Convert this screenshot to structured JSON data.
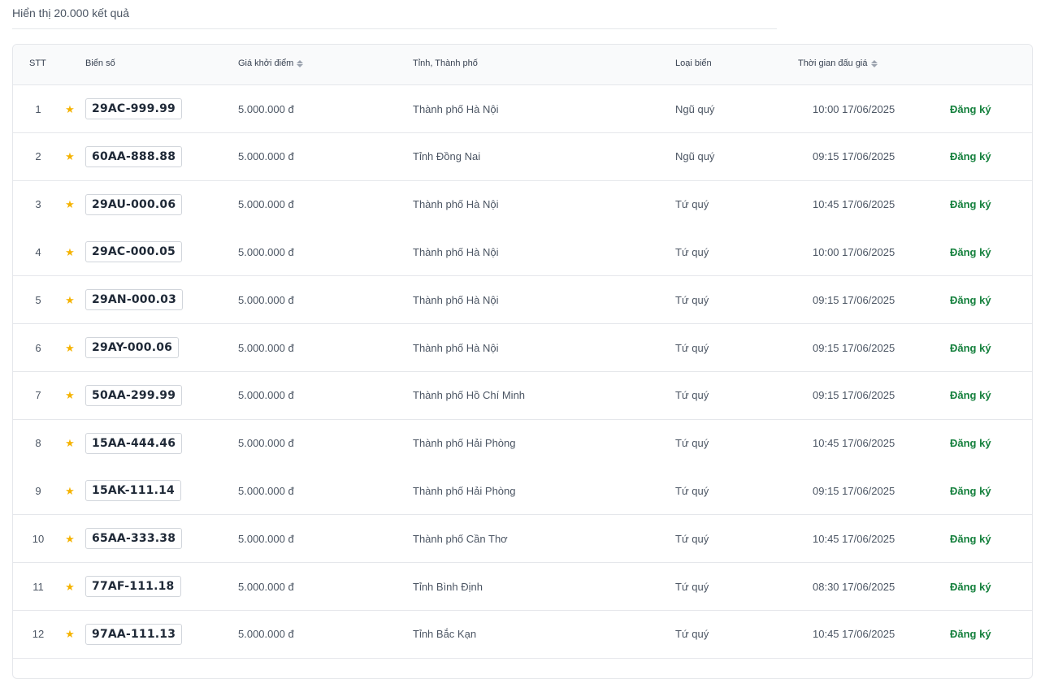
{
  "results": {
    "summary": "Hiển thị 20.000 kết quả"
  },
  "table": {
    "headers": {
      "stt": "STT",
      "plate": "Biển số",
      "price": "Giá khởi điểm",
      "province": "Tỉnh, Thành phố",
      "type": "Loại biển",
      "time": "Thời gian đấu giá"
    },
    "star_icon": "star-icon",
    "star_color": "#f5b301",
    "action_color": "#15803d",
    "rows": [
      {
        "stt": "1",
        "plate": "29AC-999.99",
        "price": "5.000.000 đ",
        "province": "Thành phố Hà Nội",
        "type": "Ngũ quý",
        "time": "10:00 17/06/2025",
        "action": "Đăng ký"
      },
      {
        "stt": "2",
        "plate": "60AA-888.88",
        "price": "5.000.000 đ",
        "province": "Tỉnh Đồng Nai",
        "type": "Ngũ quý",
        "time": "09:15 17/06/2025",
        "action": "Đăng ký"
      },
      {
        "stt": "3",
        "plate": "29AU-000.06",
        "price": "5.000.000 đ",
        "province": "Thành phố Hà Nội",
        "type": "Tứ quý",
        "time": "10:45 17/06/2025",
        "action": "Đăng ký"
      },
      {
        "stt": "4",
        "plate": "29AC-000.05",
        "price": "5.000.000 đ",
        "province": "Thành phố Hà Nội",
        "type": "Tứ quý",
        "time": "10:00 17/06/2025",
        "action": "Đăng ký"
      },
      {
        "stt": "5",
        "plate": "29AN-000.03",
        "price": "5.000.000 đ",
        "province": "Thành phố Hà Nội",
        "type": "Tứ quý",
        "time": "09:15 17/06/2025",
        "action": "Đăng ký"
      },
      {
        "stt": "6",
        "plate": "29AY-000.06",
        "price": "5.000.000 đ",
        "province": "Thành phố Hà Nội",
        "type": "Tứ quý",
        "time": "09:15 17/06/2025",
        "action": "Đăng ký"
      },
      {
        "stt": "7",
        "plate": "50AA-299.99",
        "price": "5.000.000 đ",
        "province": "Thành phố Hồ Chí Minh",
        "type": "Tứ quý",
        "time": "09:15 17/06/2025",
        "action": "Đăng ký"
      },
      {
        "stt": "8",
        "plate": "15AA-444.46",
        "price": "5.000.000 đ",
        "province": "Thành phố Hải Phòng",
        "type": "Tứ quý",
        "time": "10:45 17/06/2025",
        "action": "Đăng ký"
      },
      {
        "stt": "9",
        "plate": "15AK-111.14",
        "price": "5.000.000 đ",
        "province": "Thành phố Hải Phòng",
        "type": "Tứ quý",
        "time": "09:15 17/06/2025",
        "action": "Đăng ký"
      },
      {
        "stt": "10",
        "plate": "65AA-333.38",
        "price": "5.000.000 đ",
        "province": "Thành phố Cần Thơ",
        "type": "Tứ quý",
        "time": "10:45 17/06/2025",
        "action": "Đăng ký"
      },
      {
        "stt": "11",
        "plate": "77AF-111.18",
        "price": "5.000.000 đ",
        "province": "Tỉnh Bình Định",
        "type": "Tứ quý",
        "time": "08:30 17/06/2025",
        "action": "Đăng ký"
      },
      {
        "stt": "12",
        "plate": "97AA-111.13",
        "price": "5.000.000 đ",
        "province": "Tỉnh Bắc Kạn",
        "type": "Tứ quý",
        "time": "10:45 17/06/2025",
        "action": "Đăng ký"
      }
    ]
  }
}
